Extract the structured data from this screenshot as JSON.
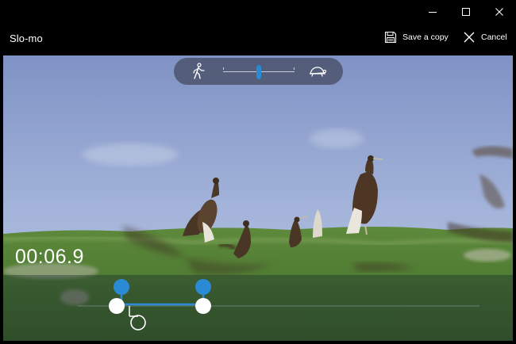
{
  "window": {
    "title": "Slo-mo",
    "minimize_label": "Minimize",
    "maximize_label": "Maximize",
    "close_label": "Close"
  },
  "commands": {
    "save_copy": "Save a copy",
    "cancel": "Cancel"
  },
  "speed": {
    "left_icon": "walking-person-icon",
    "right_icon": "turtle-icon",
    "level_fraction": 0.5
  },
  "timeline": {
    "current_time": "00:06.9"
  },
  "colors": {
    "accent": "#2a8ad4",
    "chrome": "#000000",
    "text": "#ffffff"
  }
}
